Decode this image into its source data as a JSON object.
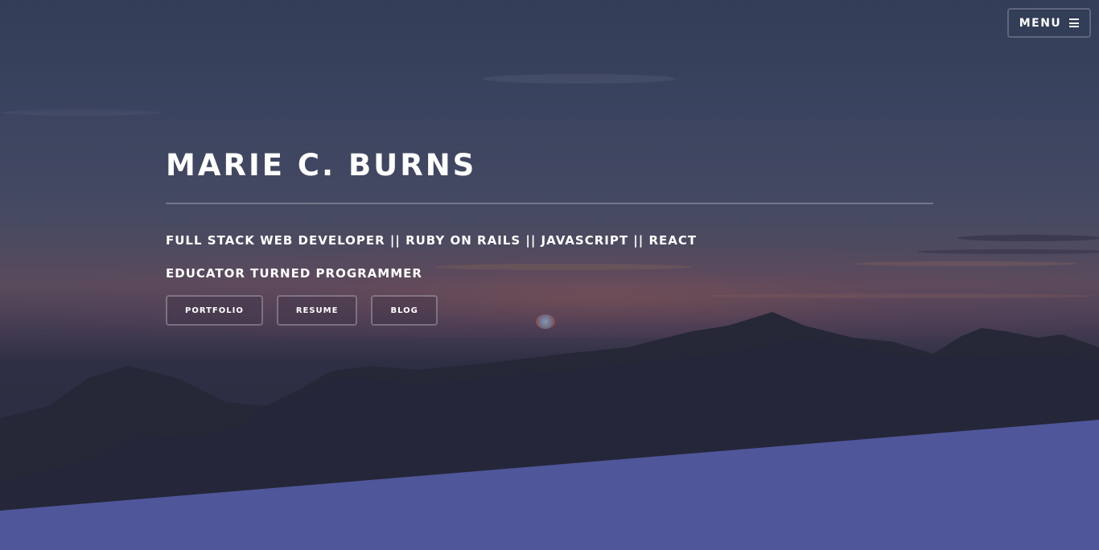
{
  "header": {
    "menu_label": "MENU",
    "menu_icon": "hamburger-icon"
  },
  "hero": {
    "name": "MARIE C. BURNS",
    "tagline_1": "FULL STACK WEB DEVELOPER || RUBY ON RAILS || JAVASCRIPT || REACT",
    "tagline_2": "EDUCATOR TURNED PROGRAMMER",
    "buttons": [
      {
        "label": "PORTFOLIO"
      },
      {
        "label": "RESUME"
      },
      {
        "label": "BLOG"
      }
    ]
  },
  "colors": {
    "accent_band": "#4f5699",
    "text": "#ffffff"
  }
}
